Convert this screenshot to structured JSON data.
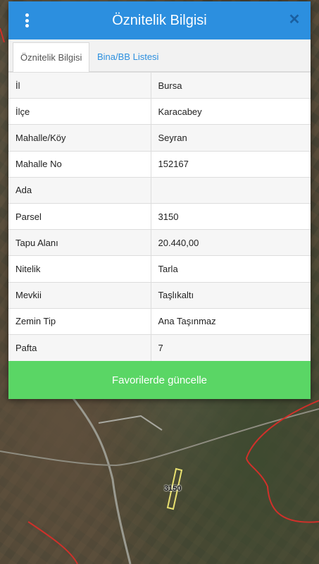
{
  "dialog": {
    "title": "Öznitelik Bilgisi",
    "menu_icon": "more-vertical-icon",
    "close_icon": "close-icon",
    "tabs": [
      {
        "label": "Öznitelik Bilgisi",
        "active": true
      },
      {
        "label": "Bina/BB Listesi",
        "active": false
      }
    ],
    "rows": [
      {
        "key": "İl",
        "value": "Bursa"
      },
      {
        "key": "İlçe",
        "value": "Karacabey"
      },
      {
        "key": "Mahalle/Köy",
        "value": "Seyran"
      },
      {
        "key": "Mahalle No",
        "value": "152167"
      },
      {
        "key": "Ada",
        "value": ""
      },
      {
        "key": "Parsel",
        "value": "3150"
      },
      {
        "key": "Tapu Alanı",
        "value": "20.440,00"
      },
      {
        "key": "Nitelik",
        "value": "Tarla"
      },
      {
        "key": "Mevkii",
        "value": "Taşlıkaltı"
      },
      {
        "key": "Zemin Tip",
        "value": "Ana Taşınmaz"
      },
      {
        "key": "Pafta",
        "value": "7"
      }
    ],
    "save_label": "Favorilerde güncelle"
  },
  "map": {
    "parcel_label": "3150"
  },
  "colors": {
    "header": "#2c8fdf",
    "save_button": "#5ad665",
    "boundary": "#d0302a",
    "parcel": "#e8e070"
  }
}
